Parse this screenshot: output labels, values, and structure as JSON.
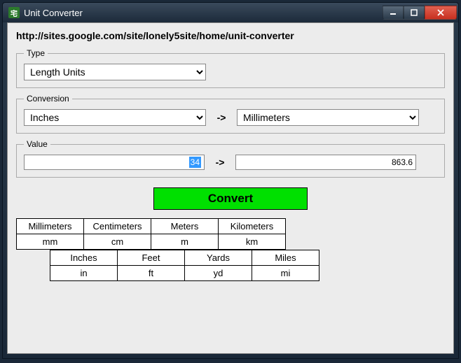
{
  "window": {
    "title": "Unit Converter",
    "icon_glyph": "宅"
  },
  "url": "http://sites.google.com/site/lonely5site/home/unit-converter",
  "type_group": {
    "legend": "Type",
    "selected": "Length Units"
  },
  "conversion_group": {
    "legend": "Conversion",
    "from_selected": "Inches",
    "arrow": "->",
    "to_selected": "Millimeters"
  },
  "value_group": {
    "legend": "Value",
    "input_value": "34",
    "arrow": "->",
    "output_value": "863.6"
  },
  "convert_button": "Convert",
  "reference": {
    "metric": {
      "names": [
        "Millimeters",
        "Centimeters",
        "Meters",
        "Kilometers"
      ],
      "abbr": [
        "mm",
        "cm",
        "m",
        "km"
      ]
    },
    "imperial": {
      "names": [
        "Inches",
        "Feet",
        "Yards",
        "Miles"
      ],
      "abbr": [
        "in",
        "ft",
        "yd",
        "mi"
      ]
    }
  }
}
